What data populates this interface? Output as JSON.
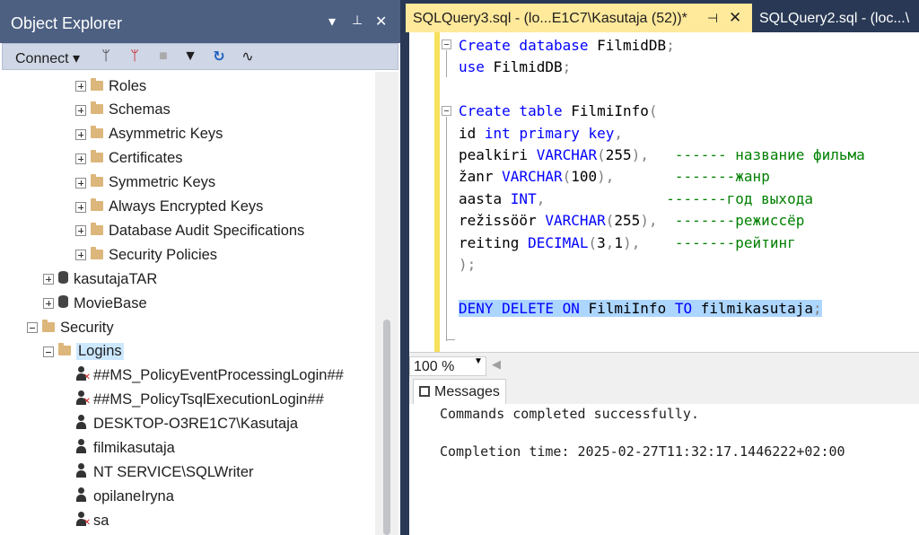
{
  "object_explorer": {
    "title": "Object Explorer",
    "dropdown_icon": "▾",
    "pin_icon": "📌",
    "close_icon": "✕",
    "connect_label": "Connect",
    "tree": [
      {
        "label": "Roles",
        "icon": "folder",
        "expander": "plus"
      },
      {
        "label": "Schemas",
        "icon": "folder",
        "expander": "plus"
      },
      {
        "label": "Asymmetric Keys",
        "icon": "folder",
        "expander": "plus"
      },
      {
        "label": "Certificates",
        "icon": "folder",
        "expander": "plus"
      },
      {
        "label": "Symmetric Keys",
        "icon": "folder",
        "expander": "plus"
      },
      {
        "label": "Always Encrypted Keys",
        "icon": "folder",
        "expander": "plus"
      },
      {
        "label": "Database Audit Specifications",
        "icon": "folder",
        "expander": "plus"
      },
      {
        "label": "Security Policies",
        "icon": "folder",
        "expander": "plus"
      },
      {
        "label": "kasutajaTAR",
        "icon": "database",
        "expander": "plus"
      },
      {
        "label": "MovieBase",
        "icon": "database",
        "expander": "plus"
      },
      {
        "label": "Security",
        "icon": "folder",
        "expander": "minus"
      },
      {
        "label": "Logins",
        "icon": "folder",
        "expander": "minus"
      },
      {
        "label": "##MS_PolicyEventProcessingLogin##",
        "icon": "user-disabled"
      },
      {
        "label": "##MS_PolicyTsqlExecutionLogin##",
        "icon": "user-disabled"
      },
      {
        "label": "DESKTOP-O3RE1C7\\Kasutaja",
        "icon": "user"
      },
      {
        "label": "filmikasutaja",
        "icon": "user"
      },
      {
        "label": "NT SERVICE\\SQLWriter",
        "icon": "user"
      },
      {
        "label": "opilaneIryna",
        "icon": "user"
      },
      {
        "label": "sa",
        "icon": "user-disabled"
      }
    ]
  },
  "tabs": {
    "active": "SQLQuery3.sql - (lo...E1C7\\Kasutaja (52))*",
    "inactive": "SQLQuery2.sql - (loc...\\",
    "pin_icon": "⊣",
    "close_icon": "✕"
  },
  "editor": {
    "lines": [
      {
        "parts": [
          [
            "kw",
            "Create database "
          ],
          [
            "",
            "FilmidDB"
          ],
          [
            "gr",
            ";"
          ]
        ]
      },
      {
        "parts": [
          [
            "kw",
            "use "
          ],
          [
            "",
            "FilmidDB"
          ],
          [
            "gr",
            ";"
          ]
        ]
      },
      {
        "parts": []
      },
      {
        "parts": [
          [
            "kw",
            "Create table "
          ],
          [
            "",
            "FilmiInfo"
          ],
          [
            "gr",
            "("
          ]
        ]
      },
      {
        "parts": [
          [
            "",
            "id "
          ],
          [
            "kw",
            "int primary key"
          ],
          [
            "gr",
            ","
          ]
        ]
      },
      {
        "parts": [
          [
            "",
            "pealkiri "
          ],
          [
            "kw",
            "VARCHAR"
          ],
          [
            "gr",
            "("
          ],
          [
            "",
            "255"
          ],
          [
            "gr",
            "),"
          ],
          [
            "",
            "   "
          ],
          [
            "cm",
            "------ название фильма"
          ]
        ]
      },
      {
        "parts": [
          [
            "",
            "žanr "
          ],
          [
            "kw",
            "VARCHAR"
          ],
          [
            "gr",
            "("
          ],
          [
            "",
            "100"
          ],
          [
            "gr",
            "),"
          ],
          [
            "",
            "       "
          ],
          [
            "cm",
            "-------жанр"
          ]
        ]
      },
      {
        "parts": [
          [
            "",
            "aasta "
          ],
          [
            "kw",
            "INT"
          ],
          [
            "gr",
            ","
          ],
          [
            "",
            "              "
          ],
          [
            "cm",
            "-------год выхода"
          ]
        ]
      },
      {
        "parts": [
          [
            "",
            "režissöör "
          ],
          [
            "kw",
            "VARCHAR"
          ],
          [
            "gr",
            "("
          ],
          [
            "",
            "255"
          ],
          [
            "gr",
            "),"
          ],
          [
            "",
            "  "
          ],
          [
            "cm",
            "-------режиссёр"
          ]
        ]
      },
      {
        "parts": [
          [
            "",
            "reiting "
          ],
          [
            "kw",
            "DECIMAL"
          ],
          [
            "gr",
            "("
          ],
          [
            "",
            "3"
          ],
          [
            "gr",
            ","
          ],
          [
            "",
            "1"
          ],
          [
            "gr",
            "),"
          ],
          [
            "",
            "    "
          ],
          [
            "cm",
            "-------рейтинг"
          ]
        ]
      },
      {
        "parts": [
          [
            "gr",
            ");"
          ]
        ]
      },
      {
        "parts": []
      },
      {
        "parts": [
          [
            "kw",
            "DENY DELETE ON "
          ],
          [
            "",
            "FilmiInfo "
          ],
          [
            "kw",
            "TO "
          ],
          [
            "",
            "filmikasutaja"
          ],
          [
            "gr",
            ";"
          ]
        ],
        "highlight": true
      }
    ]
  },
  "zoom": {
    "value": "100 %",
    "arrow": "▼",
    "scroll_left": "◀"
  },
  "messages": {
    "tab_label": "Messages",
    "lines": [
      "Commands completed successfully.",
      "",
      "Completion time: 2025-02-27T11:32:17.1446222+02:00"
    ]
  }
}
